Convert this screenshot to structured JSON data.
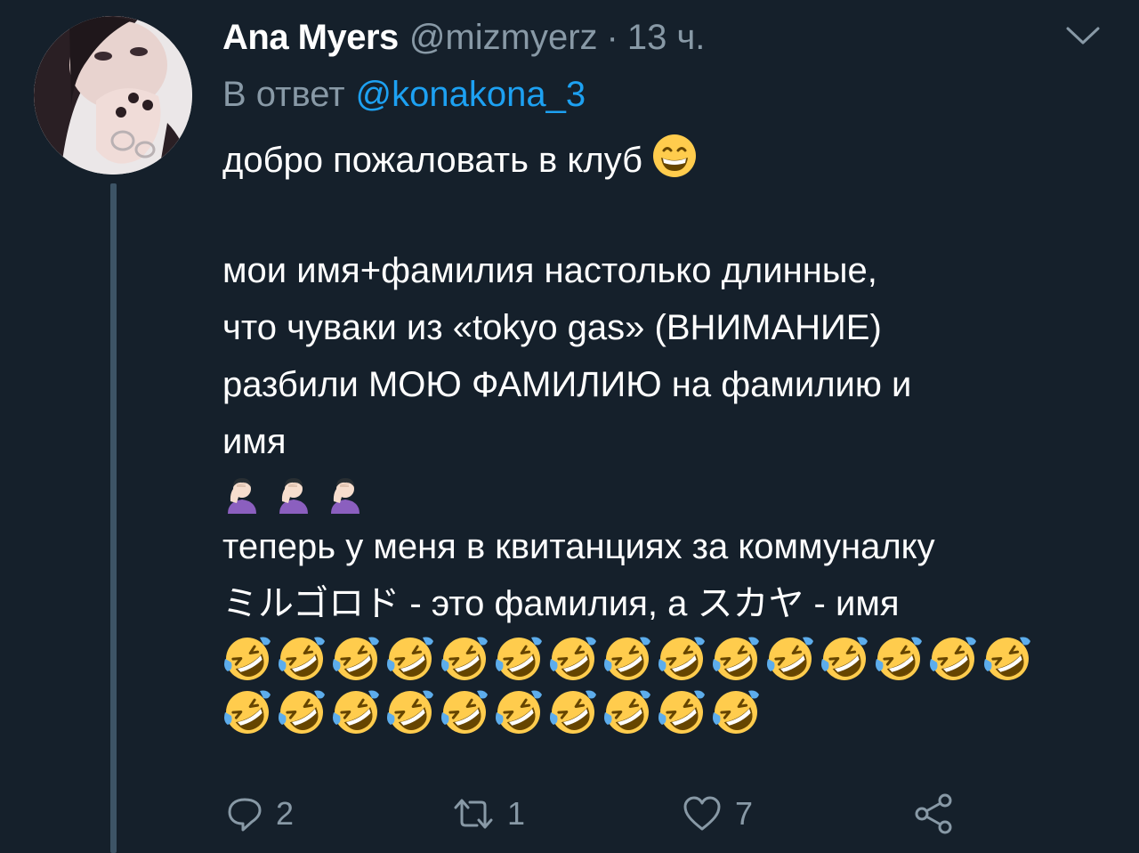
{
  "tweet": {
    "author_name": "Ana Myers",
    "author_handle": "@mizmyerz",
    "separator": "·",
    "time": "13 ч.",
    "reply_label": "В ответ",
    "reply_mention": "@konakona_3",
    "body": {
      "line1": "добро пожаловать в клуб",
      "line2": "мои имя+фамилия настолько длинные,",
      "line3": "что чуваки из «tokyo gas» (ВНИМАНИЕ)",
      "line4": "разбили МОЮ ФАМИЛИЮ на фамилию и",
      "line5": "имя",
      "line6": "теперь у меня в квитанциях за коммуналку",
      "line7": "ミルゴロド - это фамилия, а スカヤ - имя"
    },
    "emojis": {
      "inline_after_line1": "grinning-face-emoji",
      "facepalm_row": [
        "person-facepalming-emoji",
        "person-facepalming-emoji",
        "person-facepalming-emoji"
      ],
      "laughing_row1_count_label": "15",
      "laughing_row2_count_label": "10",
      "laughing_emoji": "rolling-on-the-floor-laughing-emoji"
    },
    "actions": {
      "reply_count": "2",
      "retweet_count": "1",
      "like_count": "7"
    },
    "colors": {
      "background": "#15202b",
      "secondary_text": "#8899a6",
      "link": "#1da1f2",
      "thread_line": "#3d5466"
    }
  }
}
